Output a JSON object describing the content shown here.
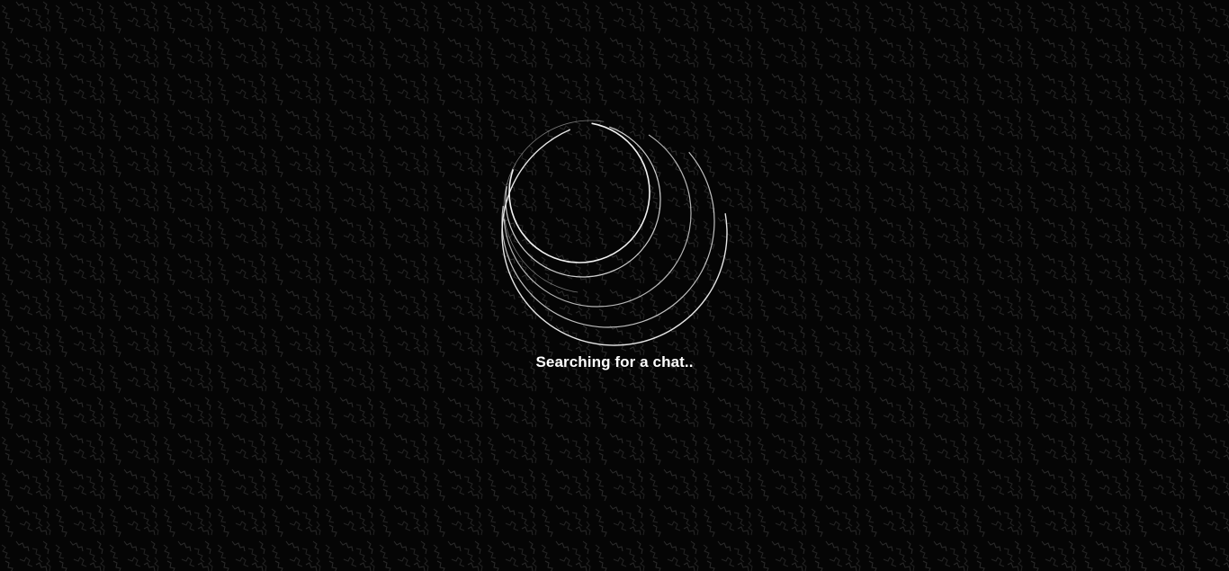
{
  "loader": {
    "status_text": "Searching for a chat..",
    "icon": "spinner-rings-icon"
  },
  "colors": {
    "background": "#050505",
    "pattern": "#2a2a2a",
    "ring": "#ffffff",
    "text": "#ffffff"
  }
}
